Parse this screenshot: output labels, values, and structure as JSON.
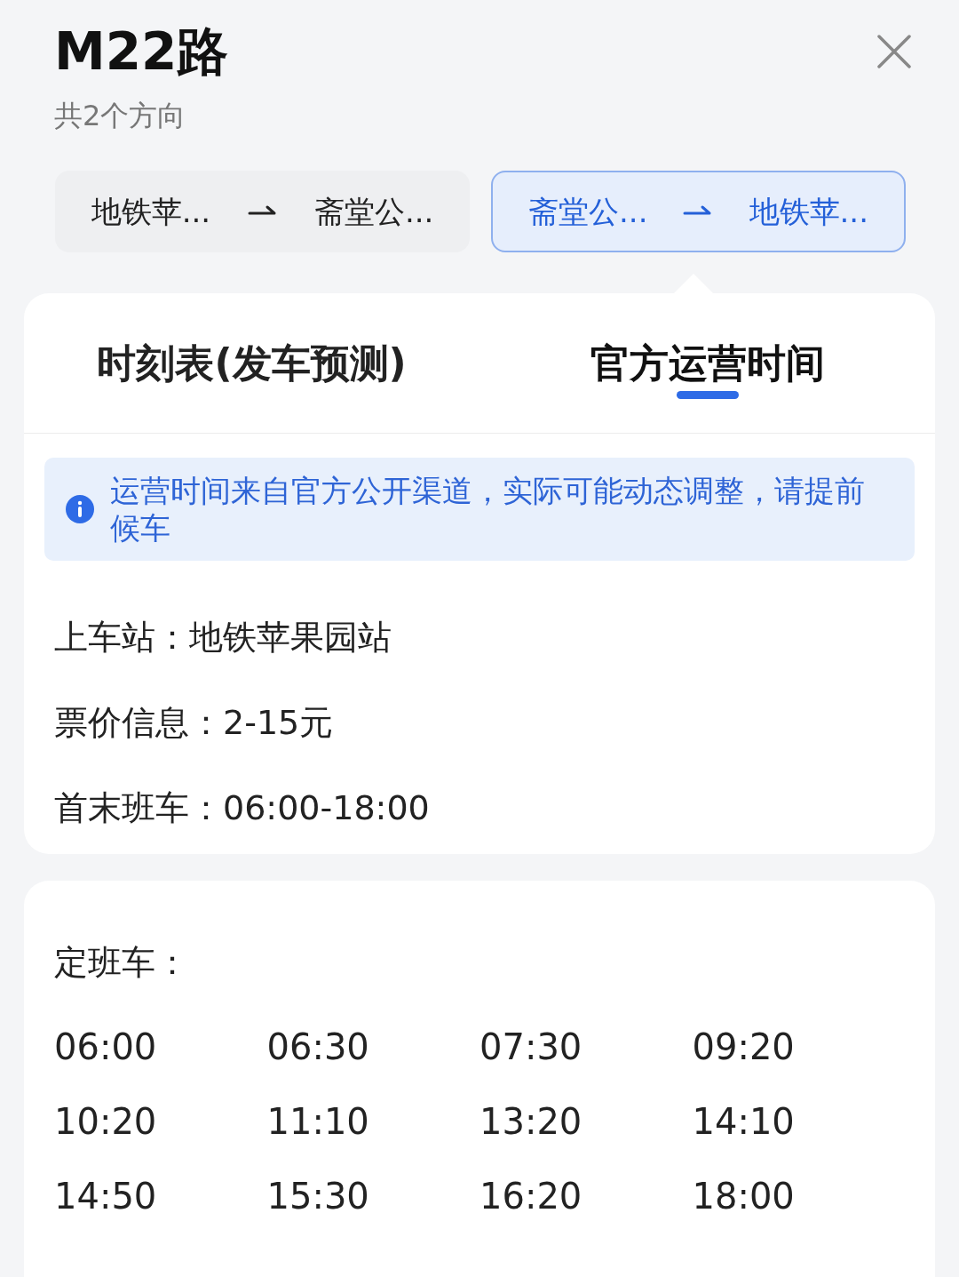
{
  "header": {
    "title": "M22路",
    "subtitle": "共2个方向"
  },
  "directions": [
    {
      "from": "地铁苹...",
      "to": "斋堂公...",
      "selected": false
    },
    {
      "from": "斋堂公...",
      "to": "地铁苹...",
      "selected": true
    }
  ],
  "tabs": [
    {
      "label": "时刻表(发车预测)",
      "selected": false
    },
    {
      "label": "官方运营时间",
      "selected": true
    }
  ],
  "notice": {
    "text": "运营时间来自官方公开渠道，实际可能动态调整，请提前候车"
  },
  "info_rows": [
    {
      "label": "上车站：",
      "value": "地铁苹果园站"
    },
    {
      "label": "票价信息：",
      "value": "2-15元"
    },
    {
      "label": "首末班车：",
      "value": "06:00-18:00"
    }
  ],
  "schedule": {
    "title": "定班车：",
    "times": [
      "06:00",
      "06:30",
      "07:30",
      "09:20",
      "10:20",
      "11:10",
      "13:20",
      "14:10",
      "14:50",
      "15:30",
      "16:20",
      "18:00"
    ]
  }
}
